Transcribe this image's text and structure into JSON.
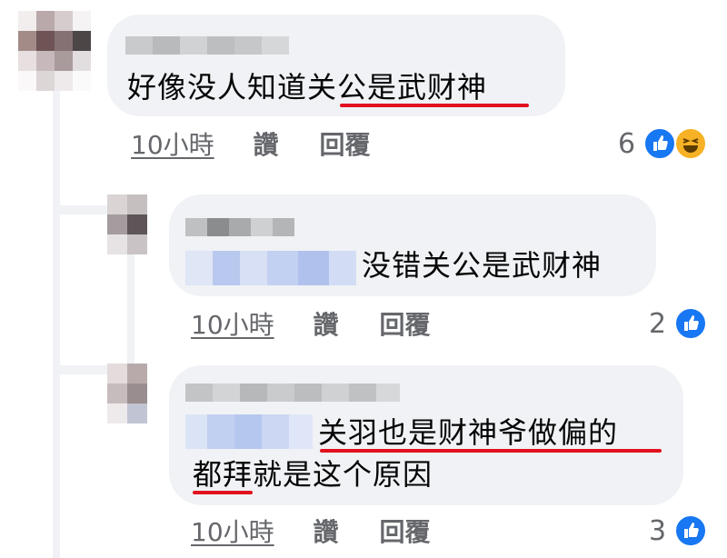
{
  "comments": [
    {
      "author_name": "",
      "text": "好像没人知道关公是武财神",
      "text_plain": "好像没人知道",
      "text_underlined": "关公是武财神",
      "time": "10小時",
      "like_label": "讚",
      "reply_label": "回覆",
      "reaction_count": "6",
      "reactions": [
        "like-icon",
        "haha-icon"
      ]
    },
    {
      "author_name": "",
      "text": "没错关公是武财神",
      "time": "10小時",
      "like_label": "讚",
      "reply_label": "回覆",
      "reaction_count": "2",
      "reactions": [
        "like-icon"
      ]
    },
    {
      "author_name": "",
      "text_line1": "关羽也是财神爷做偏的",
      "text_line2_underlined": "都拜",
      "text_line2_rest": "就是这个原因",
      "time": "10小時",
      "like_label": "讚",
      "reply_label": "回覆",
      "reaction_count": "3",
      "reactions": [
        "like-icon"
      ]
    }
  ],
  "colors": {
    "bubble": "#f0f2f5",
    "meta_text": "#65676b",
    "like_blue": "#1877f2",
    "haha_yellow": "#f7b125",
    "annotation_red": "#e1121e"
  }
}
